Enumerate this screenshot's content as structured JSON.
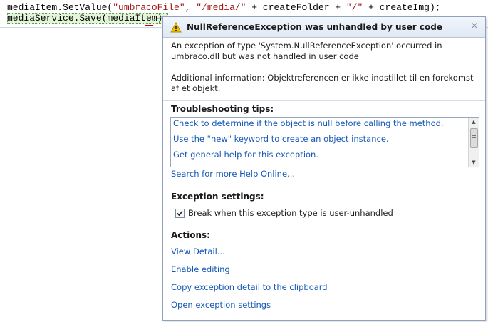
{
  "editor": {
    "line1": {
      "p1": "mediaItem.SetValue(",
      "s1": "\"umbracoFile\"",
      "p2": ", ",
      "s2": "\"/media/\"",
      "p3": " + createFolder + ",
      "s3": "\"/\"",
      "p4": " + createImg);"
    },
    "line2": "mediaService.Save(mediaItem);"
  },
  "popup": {
    "icon": "warning-icon",
    "title": "NullReferenceException was unhandled by user code",
    "close_glyph": "×",
    "message": "An exception of type 'System.NullReferenceException' occurred in umbraco.dll but was not handled in user code",
    "additional_info": "Additional information: Objektreferencen er ikke indstillet til en forekomst af et objekt.",
    "troubleshooting": {
      "heading": "Troubleshooting tips:",
      "tips": [
        "Check to determine if the object is null before calling the method.",
        "Use the \"new\" keyword to create an object instance.",
        "Get general help for this exception."
      ],
      "search_link": "Search for more Help Online..."
    },
    "exception_settings": {
      "heading": "Exception settings:",
      "checkbox_label": "Break when this exception type is user-unhandled",
      "checked": true
    },
    "actions": {
      "heading": "Actions:",
      "items": [
        "View Detail...",
        "Enable editing",
        "Copy exception detail to the clipboard",
        "Open exception settings"
      ]
    }
  },
  "colors": {
    "link": "#1558b8",
    "string_literal": "#a31515",
    "highlight": "#e3f5d8",
    "warning": "#f2c200"
  }
}
